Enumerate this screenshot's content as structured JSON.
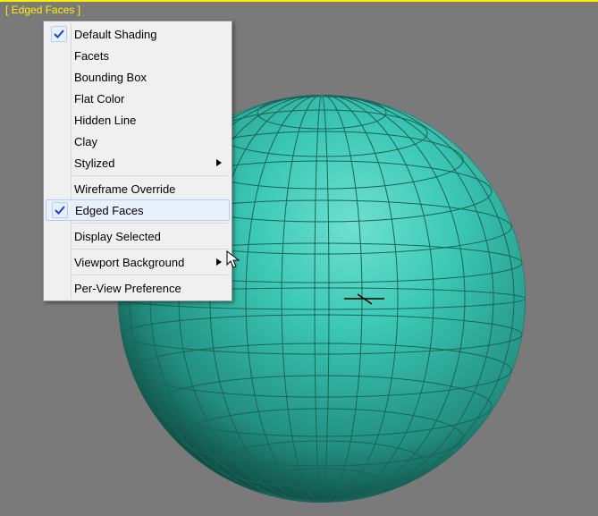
{
  "viewport_label": "[ Edged Faces ]",
  "menu": {
    "items": [
      {
        "label": "Default Shading",
        "checked": true
      },
      {
        "label": "Facets",
        "checked": false
      },
      {
        "label": "Bounding Box",
        "checked": false
      },
      {
        "label": "Flat Color",
        "checked": false
      },
      {
        "label": "Hidden Line",
        "checked": false
      },
      {
        "label": "Clay",
        "checked": false
      },
      {
        "label": "Stylized",
        "checked": false,
        "submenu": true
      }
    ],
    "group2": [
      {
        "label": "Wireframe Override",
        "checked": false
      },
      {
        "label": "Edged Faces",
        "checked": true,
        "highlight": true
      }
    ],
    "group3": [
      {
        "label": "Display Selected",
        "checked": false
      }
    ],
    "group4": [
      {
        "label": "Viewport Background",
        "checked": false,
        "submenu": true
      }
    ],
    "group5": [
      {
        "label": "Per-View Preference",
        "checked": false
      }
    ]
  },
  "colors": {
    "sphere": "#3cc9b6",
    "sphere_dark": "#166b5e",
    "sphere_line": "#1a6458",
    "bg": "#7a7a7a",
    "accent": "#ffee00"
  }
}
